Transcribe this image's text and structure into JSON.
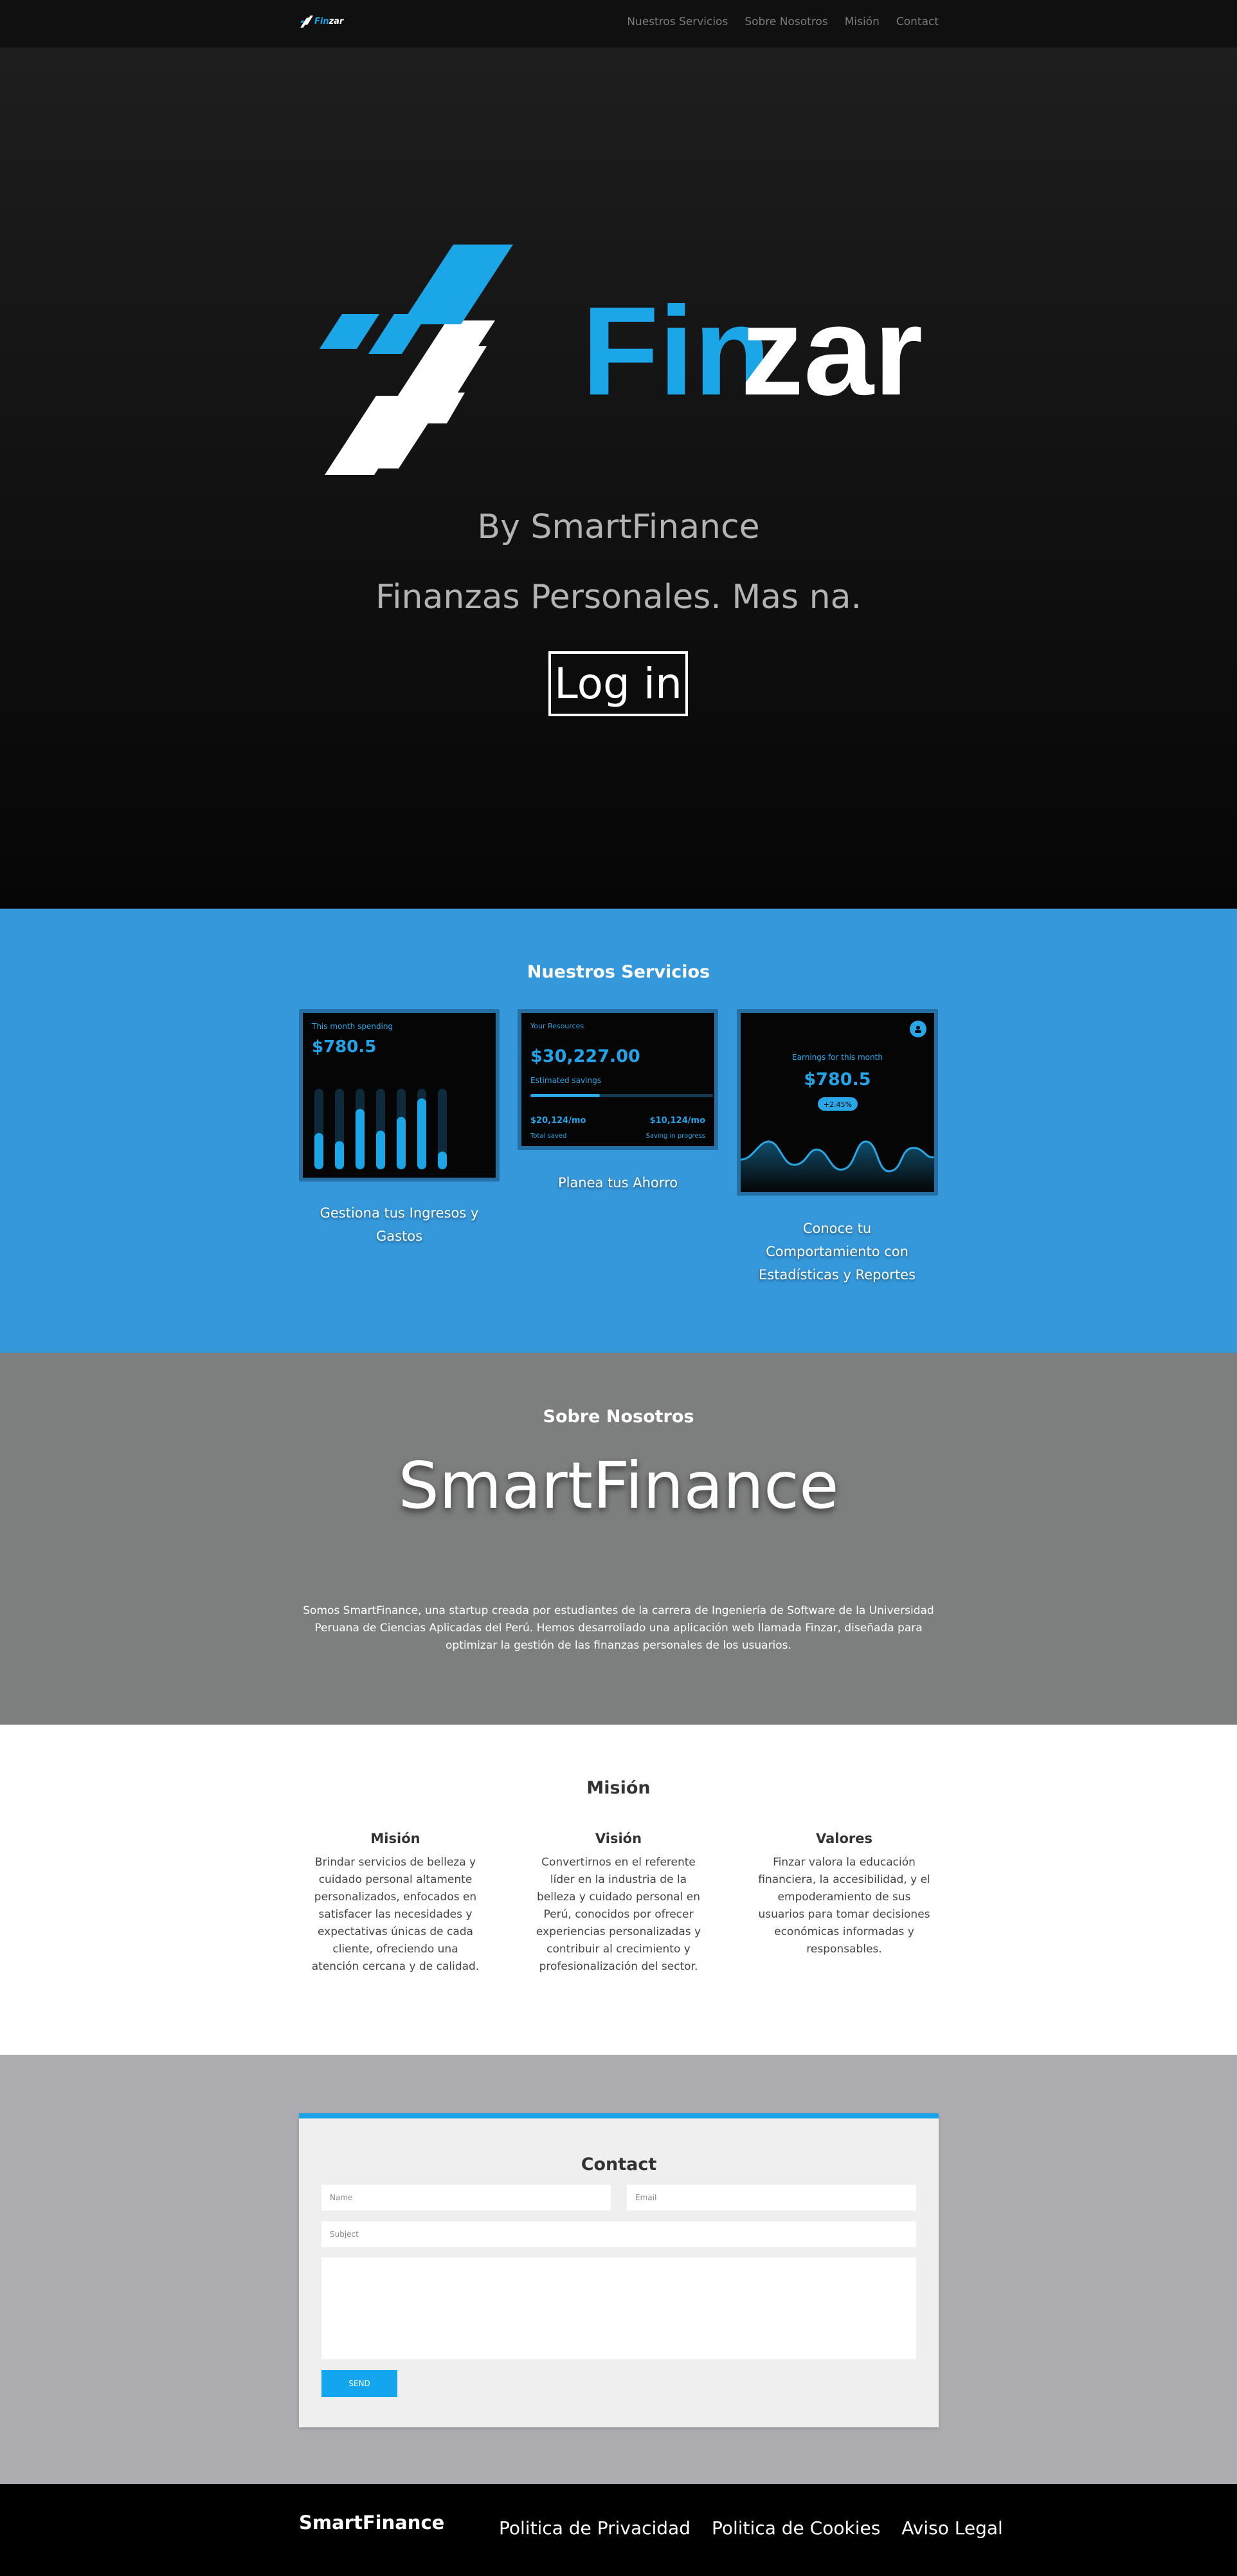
{
  "brand": {
    "name": "Finzar",
    "name_prefix": "Fin",
    "name_suffix": "zar",
    "accent": "#1ba6e7"
  },
  "nav": {
    "links": [
      "Nuestros Servicios",
      "Sobre Nosotros",
      "Misión",
      "Contact"
    ]
  },
  "hero": {
    "by_line": "By SmartFinance",
    "tagline": "Finanzas Personales. Mas na.",
    "login_label": "Log in"
  },
  "services": {
    "title": "Nuestros Servicios",
    "card1": {
      "caption": "This month spending",
      "amount": "$780.5",
      "bar_levels": [
        0.45,
        0.35,
        0.75,
        0.48,
        0.65,
        0.88,
        0.22
      ],
      "label": "Gestiona tus Ingresos y Gastos"
    },
    "card2": {
      "caption": "Your Resources",
      "amount": "$30,227.00",
      "sub": "Estimated savings",
      "progress": 0.38,
      "left_value": "$20,124/mo",
      "left_caption": "Total saved",
      "right_value": "$10,124/mo",
      "right_caption": "Saving in progress",
      "label": "Planea tus Ahorro"
    },
    "card3": {
      "caption": "Earnings for this month",
      "amount": "$780.5",
      "badge": "+2.45%",
      "label": "Conoce tu Comportamiento con Estadísticas y Reportes"
    }
  },
  "about": {
    "title": "Sobre Nosotros",
    "brand": "SmartFinance",
    "text": "Somos SmartFinance, una startup creada por estudiantes de la carrera de Ingeniería de Software de la Universidad Peruana de Ciencias Aplicadas del Perú. Hemos desarrollado una aplicación web llamada Finzar, diseñada para optimizar la gestión de las finanzas personales de los usuarios."
  },
  "mission": {
    "title": "Misión",
    "columns": [
      {
        "title": "Misión",
        "text": "Brindar servicios de belleza y cuidado personal altamente personalizados, enfocados en satisfacer las necesidades y expectativas únicas de cada cliente, ofreciendo una atención cercana y de calidad."
      },
      {
        "title": "Visión",
        "text": "Convertirnos en el referente líder en la industria de la belleza y cuidado personal en Perú, conocidos por ofrecer experiencias personalizadas y contribuir al crecimiento y profesionalización del sector."
      },
      {
        "title": "Valores",
        "text": "Finzar valora la educación financiera, la accesibilidad, y el empoderamiento de sus usuarios para tomar decisiones económicas informadas y responsables."
      }
    ]
  },
  "contact": {
    "title": "Contact",
    "name_placeholder": "Name",
    "email_placeholder": "Email",
    "subject_placeholder": "Subject",
    "send_label": "SEND"
  },
  "footer": {
    "brand": "SmartFinance",
    "links": [
      "Politica de Privacidad",
      "Politica de Cookies",
      "Aviso Legal"
    ]
  }
}
